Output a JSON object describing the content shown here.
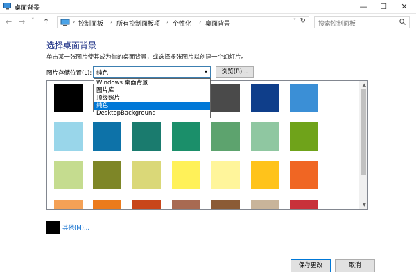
{
  "window": {
    "title": "桌面背景",
    "controls": [
      "—",
      "☐",
      "✕"
    ]
  },
  "nav": {
    "back": "←",
    "forward": "→",
    "recent": "˅",
    "up": "↑",
    "breadcrumbs": [
      "控制面板",
      "所有控制面板项",
      "个性化",
      "桌面背景"
    ],
    "separator": "›",
    "dropdown": "˅",
    "refresh": "↻"
  },
  "search": {
    "placeholder": "搜索控制面板"
  },
  "main": {
    "heading": "选择桌面背景",
    "description": "单击某一张图片使其成为你的桌面背景，或选择多张图片以创建一个幻灯片。",
    "location_label": "图片存储位置(L):",
    "location_value": "纯色",
    "select_arrow": "▾",
    "browse_label": "浏览(B)...",
    "dropdown_options": [
      "Windows 桌面背景",
      "图片库",
      "顶级照片",
      "纯色",
      "DesktopBackground"
    ],
    "selected_option_index": 3,
    "swatch_colors": [
      "#000000",
      "#6e6e6e",
      "#8c8c8c",
      "#b4b4b4",
      "#4a4a4a",
      "#0f3e8a",
      "#3b8fd6",
      "#99d6ea",
      "#0d72a8",
      "#1a7b6e",
      "#1b8f6a",
      "#5da36e",
      "#8fc7a1",
      "#6fa31a",
      "#c5dc8f",
      "#7e8627",
      "#dad878",
      "#fff159",
      "#fff59b",
      "#ffc31b",
      "#f06623",
      "#f4a156",
      "#ec7b1c",
      "#c8461a",
      "#a86a52",
      "#8b5b36",
      "#c8b49a",
      "#c8313a"
    ],
    "other_label": "其他(M)...",
    "other_color": "#000000"
  },
  "footer": {
    "save_label": "保存更改",
    "cancel_label": "取消"
  },
  "accent": "#0078d7"
}
